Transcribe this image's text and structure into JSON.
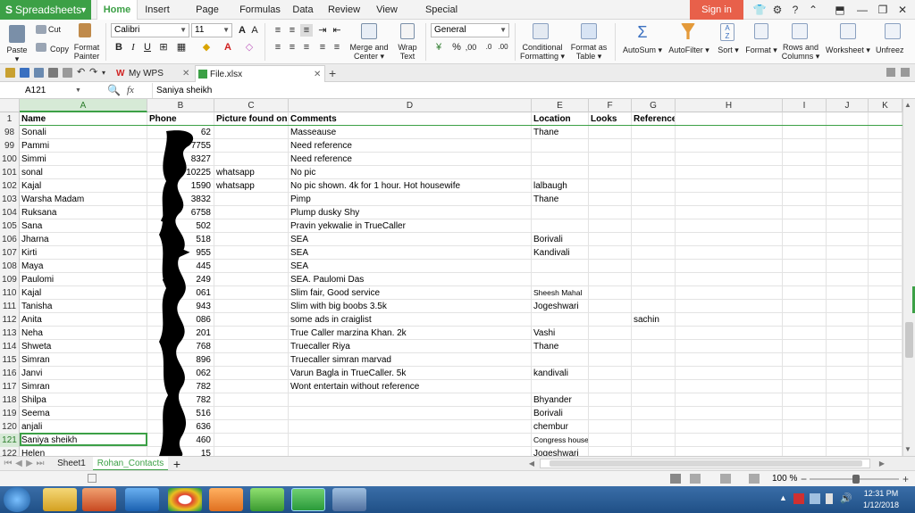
{
  "app": {
    "name": "Spreadsheets",
    "sign_in": "Sign in"
  },
  "menu_tabs": [
    "Home",
    "Insert",
    "Page Layout",
    "Formulas",
    "Data",
    "Review",
    "View",
    "Special Features"
  ],
  "ribbon": {
    "paste": "Paste",
    "cut": "Cut",
    "copy": "Copy",
    "format_painter_1": "Format",
    "format_painter_2": "Painter",
    "font_name": "Calibri",
    "font_size": "11",
    "merge_1": "Merge and",
    "merge_2": "Center",
    "wrap_1": "Wrap",
    "wrap_2": "Text",
    "number_format": "General",
    "cond_1": "Conditional",
    "cond_2": "Formatting",
    "fmt_table_1": "Format as",
    "fmt_table_2": "Table",
    "autosum": "AutoSum",
    "autofilter": "AutoFilter",
    "sort": "Sort",
    "format": "Format",
    "rows_cols_1": "Rows and",
    "rows_cols_2": "Columns",
    "worksheet": "Worksheet",
    "unfreeze": "Unfreez"
  },
  "doc_tabs": {
    "wps": "My WPS",
    "file": "File.xlsx"
  },
  "formula_bar": {
    "name_box": "A121",
    "fx": "fx",
    "content": "Saniya sheikh"
  },
  "columns": [
    "A",
    "B",
    "C",
    "D",
    "E",
    "F",
    "G",
    "H",
    "I",
    "J",
    "K"
  ],
  "header_row": {
    "num": "1",
    "cells": [
      "Name",
      "Phone",
      "Picture found on",
      "Comments",
      "Location",
      "Looks",
      "Reference"
    ]
  },
  "rows": [
    {
      "num": "98",
      "cells": [
        "Sonali",
        "62",
        "",
        "Masseause",
        "Thane",
        "",
        ""
      ]
    },
    {
      "num": "99",
      "cells": [
        "Pammi",
        "7755",
        "",
        "Need reference",
        "",
        "",
        ""
      ]
    },
    {
      "num": "100",
      "cells": [
        "Simmi",
        "8327",
        "",
        "Need reference",
        "",
        "",
        ""
      ]
    },
    {
      "num": "101",
      "cells": [
        "sonal",
        "10225",
        "whatsapp",
        "No pic",
        "",
        "",
        ""
      ]
    },
    {
      "num": "102",
      "cells": [
        "Kajal",
        "1590",
        "whatsapp",
        "No pic shown. 4k for 1 hour. Hot housewife",
        "lalbaugh",
        "",
        ""
      ]
    },
    {
      "num": "103",
      "cells": [
        "Warsha Madam",
        "3832",
        "",
        "Pimp",
        "Thane",
        "",
        ""
      ]
    },
    {
      "num": "104",
      "cells": [
        "Ruksana",
        "6758",
        "",
        "Plump dusky Shy",
        "",
        "",
        ""
      ]
    },
    {
      "num": "105",
      "cells": [
        "Sana",
        "502",
        "",
        "Pravin yekwalie in TrueCaller",
        "",
        "",
        ""
      ]
    },
    {
      "num": "106",
      "cells": [
        "Jharna",
        "518",
        "",
        "SEA",
        "Borivali",
        "",
        ""
      ]
    },
    {
      "num": "107",
      "cells": [
        "Kirti",
        "955",
        "",
        "SEA",
        "Kandivali",
        "",
        ""
      ]
    },
    {
      "num": "108",
      "cells": [
        "Maya",
        "445",
        "",
        "SEA",
        "",
        "",
        ""
      ]
    },
    {
      "num": "109",
      "cells": [
        "Paulomi",
        "249",
        "",
        "SEA. Paulomi Das",
        "",
        "",
        ""
      ]
    },
    {
      "num": "110",
      "cells": [
        "Kajal",
        "061",
        "",
        "Slim fair, Good service",
        "Sheesh Mahal",
        "",
        ""
      ]
    },
    {
      "num": "111",
      "cells": [
        "Tanisha",
        "943",
        "",
        "Slim with big boobs 3.5k",
        "Jogeshwari",
        "",
        ""
      ]
    },
    {
      "num": "112",
      "cells": [
        "Anita",
        "086",
        "",
        "some ads in craiglist",
        "",
        "",
        "sachin"
      ]
    },
    {
      "num": "113",
      "cells": [
        "Neha",
        "201",
        "",
        "True Caller marzina Khan. 2k",
        "Vashi",
        "",
        ""
      ]
    },
    {
      "num": "114",
      "cells": [
        "Shweta",
        "768",
        "",
        "Truecaller Riya",
        "Thane",
        "",
        ""
      ]
    },
    {
      "num": "115",
      "cells": [
        "Simran",
        "896",
        "",
        "Truecaller simran marvad",
        "",
        "",
        ""
      ]
    },
    {
      "num": "116",
      "cells": [
        "Janvi",
        "062",
        "",
        "Varun Bagla in TrueCaller. 5k",
        "kandivali",
        "",
        ""
      ]
    },
    {
      "num": "117",
      "cells": [
        "Simran",
        "782",
        "",
        "Wont entertain without reference",
        "",
        "",
        ""
      ]
    },
    {
      "num": "118",
      "cells": [
        "Shilpa",
        "782",
        "",
        "",
        "Bhyander",
        "",
        ""
      ]
    },
    {
      "num": "119",
      "cells": [
        "Seema",
        "516",
        "",
        "",
        "Borivali",
        "",
        ""
      ]
    },
    {
      "num": "120",
      "cells": [
        "anjali",
        "636",
        "",
        "",
        "chembur",
        "",
        ""
      ]
    },
    {
      "num": "121",
      "cells": [
        "Saniya sheikh",
        "460",
        "",
        "",
        "Congress house",
        "",
        ""
      ]
    },
    {
      "num": "122",
      "cells": [
        "Helen",
        "15",
        "",
        "",
        "Jogeshwari",
        "",
        ""
      ]
    }
  ],
  "sheets": [
    "Sheet1",
    "Rohan_Contacts"
  ],
  "status": {
    "zoom": "100 %"
  },
  "clock": {
    "time": "12:31 PM",
    "date": "1/12/2018"
  }
}
